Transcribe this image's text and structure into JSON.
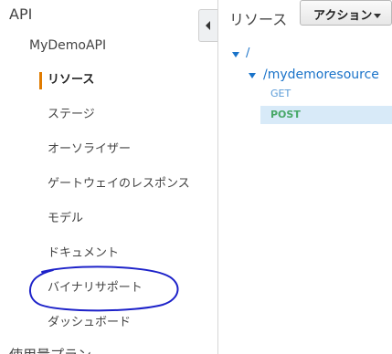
{
  "sidebar": {
    "section_title": "API",
    "api_name": "MyDemoAPI",
    "items": [
      {
        "label": "リソース",
        "active": true
      },
      {
        "label": "ステージ"
      },
      {
        "label": "オーソライザー"
      },
      {
        "label": "ゲートウェイのレスポンス"
      },
      {
        "label": "モデル"
      },
      {
        "label": "ドキュメント"
      },
      {
        "label": "バイナリサポート",
        "annotated": true
      },
      {
        "label": "ダッシュボード"
      }
    ],
    "cut_off_label": "使用量プラン"
  },
  "panel": {
    "title": "リソース",
    "actions_label": "アクション",
    "tree": {
      "root": "/",
      "child": "/mydemoresource",
      "methods": [
        "GET",
        "POST"
      ],
      "selected_method": "POST"
    }
  },
  "colors": {
    "active_bar": "#e07b00",
    "link": "#1a73c9",
    "get": "#5a9bd8",
    "post": "#48a868",
    "selected_bg": "#d8eaf8",
    "annotation": "#1d22c9"
  },
  "icons": {
    "collapse": "chevron-left-icon",
    "toggle": "caret-down-icon"
  }
}
